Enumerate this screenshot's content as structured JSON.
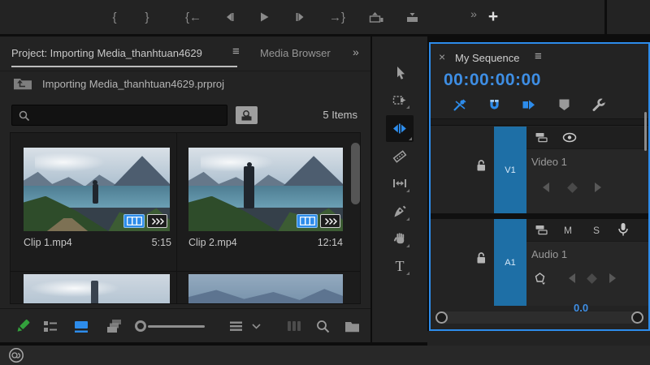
{
  "colors": {
    "accent": "#2d8ceb",
    "target-blue": "#1e6fa6",
    "timecode-blue": "#3e8ee4",
    "writable-green": "#33a03c"
  },
  "transport": {
    "mark_in": "{",
    "mark_out": "}",
    "go_to_in": "{←",
    "go_to_out": "→}",
    "more": "»",
    "add": "+"
  },
  "project_panel": {
    "active_tab": "Project: Importing Media_thanhtuan4629",
    "inactive_tab": "Media Browser",
    "menu": "≡",
    "overflow": "»",
    "project_file": "Importing Media_thanhtuan4629.prproj",
    "search_placeholder": "",
    "item_count": "5 Items",
    "clips": [
      {
        "name": "Clip 1.mp4",
        "duration": "5:15"
      },
      {
        "name": "Clip 2.mp4",
        "duration": "12:14"
      }
    ]
  },
  "tools": {
    "names": [
      "selection",
      "track-select-forward",
      "ripple-edit",
      "razor",
      "slip",
      "pen",
      "hand",
      "type"
    ],
    "active": "ripple-edit",
    "type_label": "T"
  },
  "timeline": {
    "close": "×",
    "tab": "My Sequence",
    "menu": "≡",
    "timecode": "00:00:00:00",
    "tracks": {
      "video": {
        "target": "V1",
        "name": "Video 1"
      },
      "audio": {
        "target": "A1",
        "name": "Audio 1",
        "mute": "M",
        "solo": "S"
      }
    },
    "audio_gain": "0.0"
  },
  "icons": {
    "step-back": "bar+triangle-left",
    "play": "triangle-right",
    "step-forward": "bar+triangle-right",
    "lift": "tray-up-arrow",
    "extract": "tray-down-arrow",
    "search": "magnifier",
    "find-bin": "magnifier-on-folder",
    "folder-up": "folder-parent-arrow",
    "film-badge": "filmstrip",
    "audio-badge": "waveform-chevrons",
    "writable": "green-pencil",
    "list-view": "rows",
    "icon-view": "filled-rect",
    "freeform-view": "stacked-rects",
    "zoom-slider": "knob+line",
    "sort": "three-lines+chevron",
    "filmstrip-dim": "vertical-bars",
    "new-bin": "folder",
    "nest": "pin-cross",
    "snap": "magnet",
    "linked-selection": "block+pointer",
    "marker": "pentagon-shield",
    "settings": "wrench",
    "lock": "open-padlock",
    "sync-lock": "stacked-cards",
    "toggle-output": "eye",
    "voiceover": "microphone",
    "creative-cloud": "cc-swirl"
  }
}
